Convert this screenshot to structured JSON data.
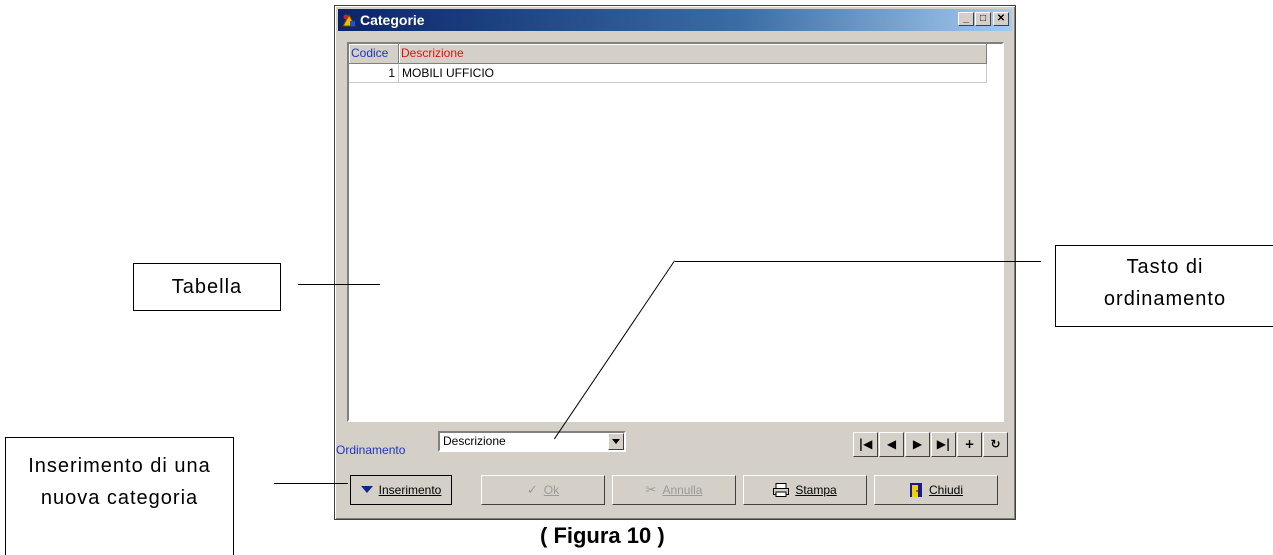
{
  "window": {
    "title": "Categorie",
    "controls": {
      "minimize": "_",
      "maximize": "□",
      "close": "✕"
    }
  },
  "grid": {
    "columns": [
      "Codice",
      "Descrizione"
    ],
    "rows": [
      {
        "codice": "1",
        "descrizione": "MOBILI UFFICIO"
      }
    ]
  },
  "sort": {
    "label": "Ordinamento",
    "value": "Descrizione"
  },
  "navigator": {
    "icons": [
      "first-record-icon",
      "prior-record-icon",
      "next-record-icon",
      "last-record-icon",
      "insert-record-icon",
      "refresh-icon"
    ],
    "glyphs": [
      "|◀",
      "◀",
      "▶",
      "▶|",
      "+",
      "↻"
    ]
  },
  "buttons": {
    "inserimento": "Inserimento",
    "ok": "Ok",
    "annulla": "Annulla",
    "stampa": "Stampa",
    "chiudi": "Chiudi"
  },
  "annotations": {
    "tabella": "Tabella",
    "tasto": "Tasto di ordinamento",
    "inserimento": "Inserimento di una nuova categoria"
  },
  "caption": "( Figura 10 )"
}
